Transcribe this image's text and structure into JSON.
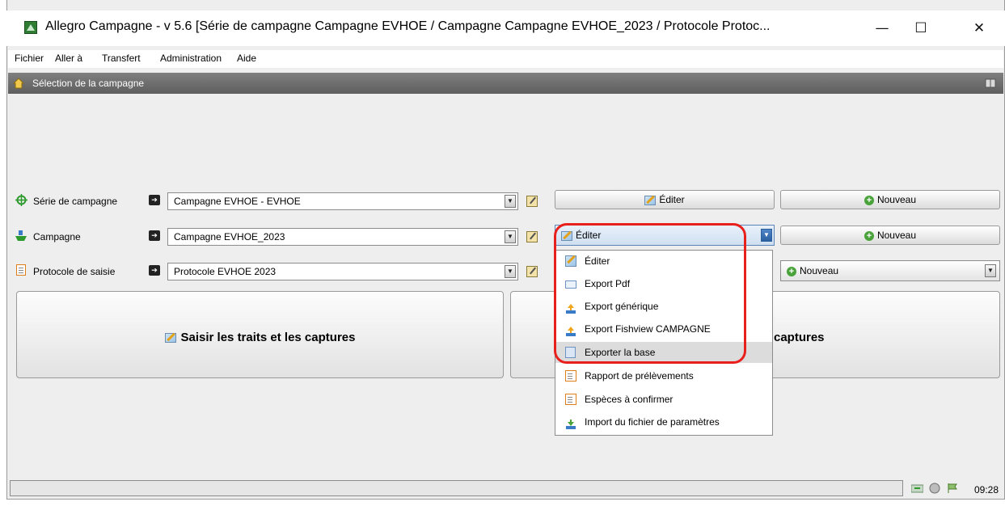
{
  "window": {
    "title": "Allegro Campagne - v 5.6 [Série de campagne Campagne EVHOE / Campagne Campagne EVHOE_2023 / Protocole Protoc...",
    "minimize": "—",
    "maximize": "☐",
    "close": "✕"
  },
  "menu": [
    "Fichier",
    "Aller à",
    "Transfert",
    "Administration",
    "Aide"
  ],
  "header": {
    "title": "Sélection de la campagne"
  },
  "rows": [
    {
      "label": "Série de campagne",
      "value": "Campagne EVHOE - EVHOE",
      "edit": "Éditer",
      "new": "Nouveau"
    },
    {
      "label": "Campagne",
      "value": "Campagne EVHOE_2023",
      "edit": "Éditer",
      "new": "Nouveau"
    },
    {
      "label": "Protocole de saisie",
      "value": "Protocole EVHOE 2023",
      "new": "Nouveau"
    }
  ],
  "actions": {
    "left": "Saisir les traits et les captures",
    "right_partial": "captures"
  },
  "dropdown": {
    "items": [
      {
        "label": "Éditer",
        "icon": "edit-icon"
      },
      {
        "label": "Export Pdf",
        "icon": "mail-icon"
      },
      {
        "label": "Export générique",
        "icon": "export-icon"
      },
      {
        "label": "Export Fishview CAMPAGNE",
        "icon": "export-icon"
      },
      {
        "label": "Exporter la base",
        "icon": "database-icon",
        "selected": true
      },
      {
        "label": "Rapport de prélèvements",
        "icon": "report-icon"
      },
      {
        "label": "Espèces à confirmer",
        "icon": "report-icon"
      },
      {
        "label": "Import du fichier de paramètres",
        "icon": "import-icon"
      }
    ]
  },
  "status": {
    "time": "09:28"
  },
  "colors": {
    "highlight": "#e8201c",
    "header_bg": "#6b6b6b",
    "plus": "#4aa33a"
  }
}
